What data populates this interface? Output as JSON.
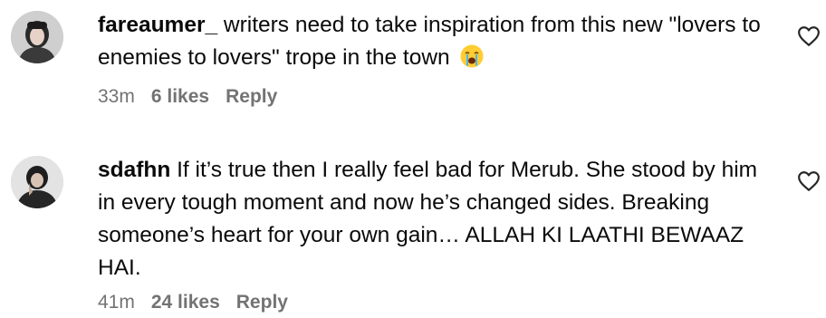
{
  "comments": [
    {
      "username": "fareaumer_",
      "text": " writers need to take inspiration from this new \"lovers to enemies to lovers\" trope in the town",
      "emoji": "loudly-crying-face",
      "time": "33m",
      "likes": "6 likes",
      "reply_label": "Reply",
      "avatar_icon": "user-avatar-icon",
      "like_icon": "heart-outline-icon"
    },
    {
      "username": "sdafhn",
      "text": " If it’s true then I really feel bad for Merub. She stood by him in every tough moment and now he’s changed sides. Breaking someone’s heart for your own gain… ALLAH KI LAATHI BEWAAZ HAI.",
      "time": "41m",
      "likes": "24 likes",
      "reply_label": "Reply",
      "avatar_icon": "user-avatar-icon",
      "like_icon": "heart-outline-icon"
    }
  ],
  "colors": {
    "text": "#0a0a0a",
    "meta": "#737373",
    "background": "#ffffff"
  }
}
